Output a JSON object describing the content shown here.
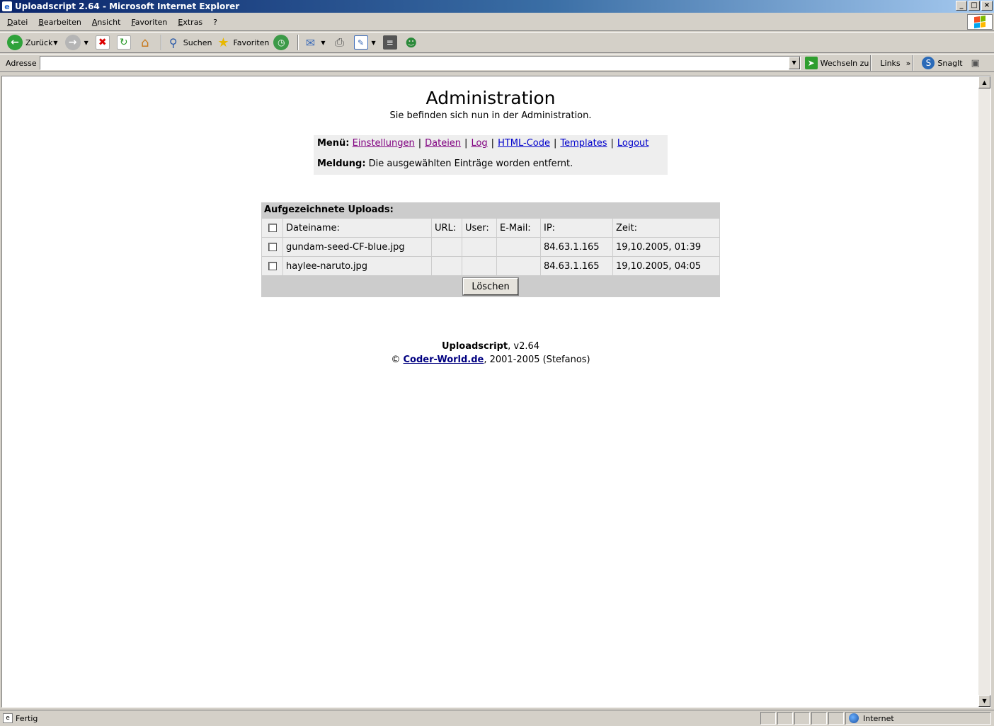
{
  "window": {
    "title": "Uploadscript 2.64 - Microsoft Internet Explorer",
    "buttons": [
      "_",
      "□",
      "×"
    ]
  },
  "menubar": {
    "items": [
      "Datei",
      "Bearbeiten",
      "Ansicht",
      "Favoriten",
      "Extras",
      "?"
    ]
  },
  "toolbar": {
    "back_label": "Zurück",
    "search_label": "Suchen",
    "favorites_label": "Favoriten"
  },
  "addressbar": {
    "label": "Adresse",
    "value": "",
    "go_label": "Wechseln zu",
    "links_label": "Links",
    "snagit_label": "SnagIt"
  },
  "page": {
    "title": "Administration",
    "subtitle": "Sie befinden sich nun in der Administration.",
    "menu_label": "Menü:",
    "menu_links": [
      "Einstellungen",
      "Dateien",
      "Log",
      "HTML-Code",
      "Templates",
      "Logout"
    ],
    "message_label": "Meldung:",
    "message_text": "Die ausgewählten Einträge worden entfernt."
  },
  "uploads": {
    "heading": "Aufgezeichnete Uploads:",
    "columns": [
      "Dateiname:",
      "URL:",
      "User:",
      "E-Mail:",
      "IP:",
      "Zeit:"
    ],
    "rows": [
      {
        "filename": "gundam-seed-CF-blue.jpg",
        "url": "",
        "user": "",
        "email": "",
        "ip": "84.63.1.165",
        "time": "19,10.2005, 01:39"
      },
      {
        "filename": "haylee-naruto.jpg",
        "url": "",
        "user": "",
        "email": "",
        "ip": "84.63.1.165",
        "time": "19,10.2005, 04:05"
      }
    ],
    "delete_label": "Löschen"
  },
  "footer": {
    "product": "Uploadscript",
    "version": ", v2.64",
    "copyright_symbol": "©",
    "link": "Coder-World.de",
    "rest": ", 2001-2005 (Stefanos)"
  },
  "statusbar": {
    "text": "Fertig",
    "zone": "Internet"
  }
}
